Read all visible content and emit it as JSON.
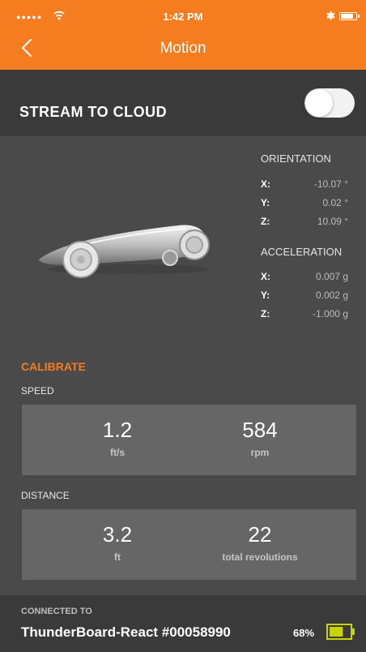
{
  "status_bar": {
    "signal_dots": "●●●●●",
    "time": "1:42 PM",
    "bluetooth_symbol": "✱"
  },
  "nav": {
    "title": "Motion",
    "back_icon": "chevron-left-icon"
  },
  "stream": {
    "label": "STREAM TO CLOUD",
    "toggle_on": false
  },
  "orientation": {
    "title": "ORIENTATION",
    "x_label": "X:",
    "x_value": "-10.07 °",
    "y_label": "Y:",
    "y_value": "0.02 °",
    "z_label": "Z:",
    "z_value": "10.09 °"
  },
  "acceleration": {
    "title": "ACCELERATION",
    "x_label": "X:",
    "x_value": "0.007 g",
    "y_label": "Y:",
    "y_value": "0.002 g",
    "z_label": "Z:",
    "z_value": "-1.000 g"
  },
  "calibrate_label": "CALIBRATE",
  "speed": {
    "label": "SPEED",
    "value1": "1.2",
    "unit1": "ft/s",
    "value2": "584",
    "unit2": "rpm"
  },
  "distance": {
    "label": "DISTANCE",
    "value1": "3.2",
    "unit1": "ft",
    "value2": "22",
    "unit2": "total revolutions"
  },
  "footer": {
    "connected_label": "CONNECTED TO",
    "device_name": "ThunderBoard-React #00058990",
    "battery_percent": "68%",
    "battery_level": 0.68
  },
  "colors": {
    "accent": "#f57c1f",
    "battery": "#c8d400"
  }
}
